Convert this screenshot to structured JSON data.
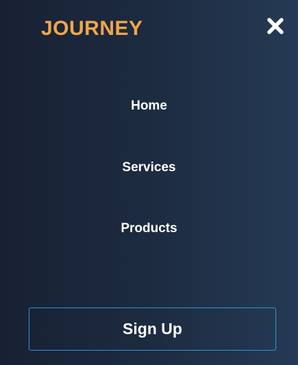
{
  "brand": {
    "logo_text": "JOURNEY",
    "accent_color": "#f2a649"
  },
  "header": {
    "close_icon": "close-icon"
  },
  "nav": {
    "items": [
      {
        "label": "Home"
      },
      {
        "label": "Services"
      },
      {
        "label": "Products"
      }
    ]
  },
  "cta": {
    "signup_label": "Sign Up",
    "border_color": "#2a9ad8"
  }
}
